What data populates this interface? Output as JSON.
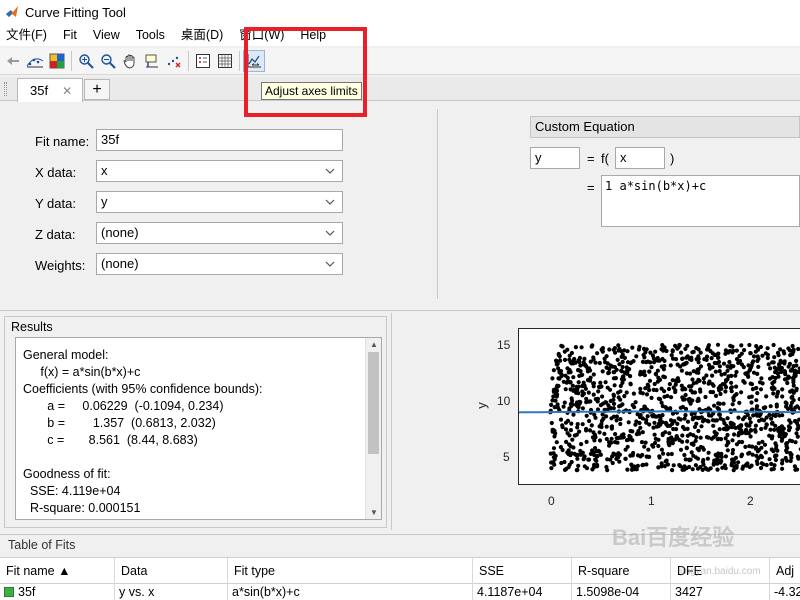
{
  "window": {
    "title": "Curve Fitting Tool"
  },
  "menu": [
    "文件(F)",
    "Fit",
    "View",
    "Tools",
    "桌面(D)",
    "窗口(W)",
    "Help"
  ],
  "toolbar": {
    "icons": [
      "back-arrow-icon",
      "fit-options-icon",
      "color-map-icon",
      "zoom-in-icon",
      "zoom-out-icon",
      "pan-hand-icon",
      "data-cursor-icon",
      "exclude-outliers-icon",
      "legend-icon",
      "grid-icon",
      "adjust-axes-limits-icon"
    ],
    "tooltip": "Adjust axes limits"
  },
  "tabs": {
    "active": "35f",
    "close": "✕",
    "add": "+"
  },
  "fit": {
    "name_label": "Fit name:",
    "name_value": "35f",
    "x_label": "X data:",
    "x_value": "x",
    "y_label": "Y data:",
    "y_value": "y",
    "z_label": "Z data:",
    "z_value": "(none)",
    "w_label": "Weights:",
    "w_value": "(none)"
  },
  "equation": {
    "type": "Custom Equation",
    "lhs": "y",
    "eq": "=",
    "f_open": "f(",
    "var": "x",
    "f_close": ")",
    "eq2": "=",
    "line_no": "1",
    "body": "a*sin(b*x)+c"
  },
  "results": {
    "title": "Results",
    "lines": [
      "General model:",
      "     f(x) = a*sin(b*x)+c",
      "Coefficients (with 95% confidence bounds):",
      "       a =     0.06229  (-0.1094, 0.234)",
      "       b =        1.357  (0.6813, 2.032)",
      "       c =       8.561  (8.44, 8.683)",
      "",
      "Goodness of fit:",
      "  SSE: 4.119e+04",
      "  R-square: 0.000151"
    ]
  },
  "chart_data": {
    "type": "scatter",
    "ylabel": "y",
    "x_ticks": [
      "0",
      "1",
      "2"
    ],
    "y_ticks": [
      "5",
      "10",
      "15"
    ],
    "xlim": [
      -0.3,
      2.4
    ],
    "ylim": [
      1.5,
      16.5
    ],
    "series": [
      {
        "kind": "points",
        "color": "#000000",
        "y_range": [
          3,
          15
        ],
        "x_range": [
          0,
          2.4
        ]
      },
      {
        "kind": "fit",
        "color": "#2e78be",
        "equation": "a*sin(b*x)+c",
        "a": 0.06229,
        "b": 1.357,
        "c": 8.561
      }
    ]
  },
  "table": {
    "title": "Table of Fits",
    "headers": [
      "Fit name ▲",
      "Data",
      "Fit type",
      "SSE",
      "R-square",
      "DFE",
      "Adj"
    ],
    "row": [
      "35f",
      "y vs. x",
      "a*sin(b*x)+c",
      "4.1187e+04",
      "1.5098e-04",
      "3427",
      "-4.32"
    ]
  },
  "watermark": {
    "main": "Bai百度经验",
    "sub": "jingyan.baidu.com"
  },
  "colors": {
    "highlight": "#e8202a",
    "fit_line": "#2e78be",
    "tooltip_bg": "#ffffe1"
  }
}
